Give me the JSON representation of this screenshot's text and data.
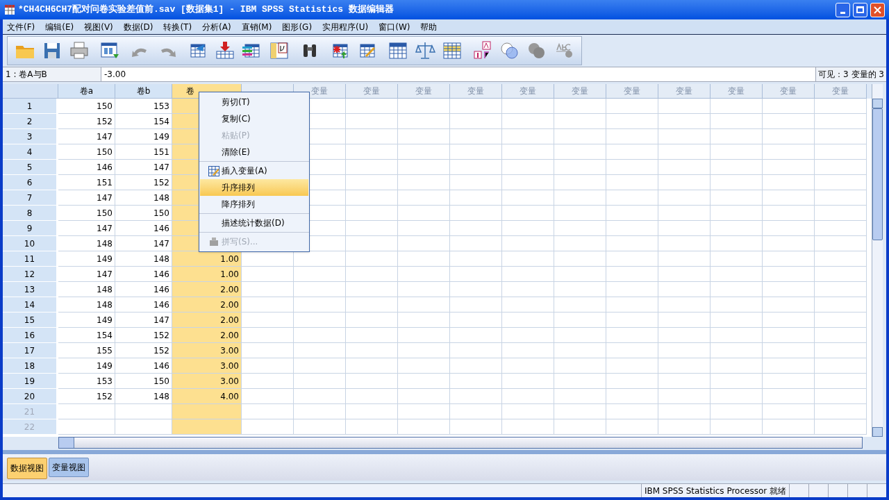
{
  "window": {
    "title": "*CH4CH6CH7配对问卷实验差值前.sav [数据集1] - IBM SPSS Statistics 数据编辑器"
  },
  "menu": [
    "文件(F)",
    "编辑(E)",
    "视图(V)",
    "数据(D)",
    "转换(T)",
    "分析(A)",
    "直销(M)",
    "图形(G)",
    "实用程序(U)",
    "窗口(W)",
    "帮助"
  ],
  "cell_editor": {
    "cell": "1 : 卷A与B",
    "value": "-3.00",
    "visible_count": "可见：3 变量的 3"
  },
  "grid": {
    "columns": [
      {
        "label": "卷a",
        "selected": false
      },
      {
        "label": "卷b",
        "selected": false
      },
      {
        "label": "卷",
        "selected": true
      },
      {
        "selected": false
      },
      {
        "label": "变量",
        "selected": false
      },
      {
        "label": "变量",
        "selected": false
      },
      {
        "label": "变量",
        "selected": false
      },
      {
        "label": "变量",
        "selected": false
      },
      {
        "label": "变量",
        "selected": false
      },
      {
        "label": "变量",
        "selected": false
      },
      {
        "label": "变量",
        "selected": false
      },
      {
        "label": "变量",
        "selected": false
      },
      {
        "label": "变量",
        "selected": false
      },
      {
        "label": "变量",
        "selected": false
      },
      {
        "label": "变量",
        "selected": false
      }
    ],
    "rows": [
      {
        "number": "1",
        "disabled": false,
        "cells": [
          "150",
          "153",
          ""
        ]
      },
      {
        "number": "2",
        "disabled": false,
        "cells": [
          "152",
          "154",
          ""
        ]
      },
      {
        "number": "3",
        "disabled": false,
        "cells": [
          "147",
          "149",
          ""
        ]
      },
      {
        "number": "4",
        "disabled": false,
        "cells": [
          "150",
          "151",
          ""
        ]
      },
      {
        "number": "5",
        "disabled": false,
        "cells": [
          "146",
          "147",
          ""
        ]
      },
      {
        "number": "6",
        "disabled": false,
        "cells": [
          "151",
          "152",
          ""
        ]
      },
      {
        "number": "7",
        "disabled": false,
        "cells": [
          "147",
          "148",
          ""
        ]
      },
      {
        "number": "8",
        "disabled": false,
        "cells": [
          "150",
          "150",
          ""
        ]
      },
      {
        "number": "9",
        "disabled": false,
        "cells": [
          "147",
          "146",
          ""
        ]
      },
      {
        "number": "10",
        "disabled": false,
        "cells": [
          "148",
          "147",
          ""
        ]
      },
      {
        "number": "11",
        "disabled": false,
        "cells": [
          "149",
          "148",
          "1.00"
        ]
      },
      {
        "number": "12",
        "disabled": false,
        "cells": [
          "147",
          "146",
          "1.00"
        ]
      },
      {
        "number": "13",
        "disabled": false,
        "cells": [
          "148",
          "146",
          "2.00"
        ]
      },
      {
        "number": "14",
        "disabled": false,
        "cells": [
          "148",
          "146",
          "2.00"
        ]
      },
      {
        "number": "15",
        "disabled": false,
        "cells": [
          "149",
          "147",
          "2.00"
        ]
      },
      {
        "number": "16",
        "disabled": false,
        "cells": [
          "154",
          "152",
          "2.00"
        ]
      },
      {
        "number": "17",
        "disabled": false,
        "cells": [
          "155",
          "152",
          "3.00"
        ]
      },
      {
        "number": "18",
        "disabled": false,
        "cells": [
          "149",
          "146",
          "3.00"
        ]
      },
      {
        "number": "19",
        "disabled": false,
        "cells": [
          "153",
          "150",
          "3.00"
        ]
      },
      {
        "number": "20",
        "disabled": false,
        "cells": [
          "152",
          "148",
          "4.00"
        ]
      },
      {
        "number": "21",
        "disabled": true,
        "cells": [
          "",
          "",
          ""
        ]
      },
      {
        "number": "22",
        "disabled": true,
        "cells": [
          "",
          "",
          ""
        ]
      }
    ]
  },
  "context_menu": {
    "groups": [
      [
        {
          "kind": "plain",
          "label": "剪切(T)",
          "disabled": false,
          "selected": false
        },
        {
          "kind": "plain",
          "label": "复制(C)",
          "disabled": false,
          "selected": false
        },
        {
          "kind": "plain",
          "label": "粘贴(P)",
          "disabled": true,
          "selected": false
        },
        {
          "kind": "plain",
          "label": "清除(E)",
          "disabled": false,
          "selected": false
        }
      ],
      [
        {
          "kind": "table",
          "label": "插入变量(A)",
          "disabled": false,
          "selected": false
        },
        {
          "kind": "plain",
          "label": "升序排列",
          "disabled": false,
          "selected": true
        },
        {
          "kind": "plain",
          "label": "降序排列",
          "disabled": false,
          "selected": false
        }
      ],
      [
        {
          "kind": "plain",
          "label": "描述统计数据(D)",
          "disabled": false,
          "selected": false
        }
      ],
      [
        {
          "kind": "stamp",
          "label": "拼写(S)...",
          "disabled": true,
          "selected": false
        }
      ]
    ]
  },
  "view_tabs": [
    {
      "label": "数据视图",
      "selected": true
    },
    {
      "label": "变量视图",
      "selected": false
    }
  ],
  "status_bar": {
    "text": "IBM SPSS Statistics Processor 就绪"
  }
}
